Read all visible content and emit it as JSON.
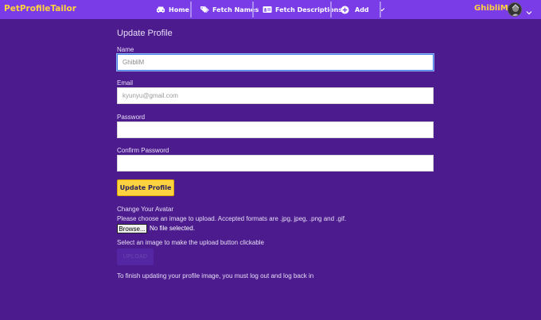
{
  "nav": {
    "brand": "PetProfileTailor",
    "home": "Home",
    "fetch_names": "Fetch Names",
    "fetch_descriptions": "Fetch Descriptions",
    "add": "Add",
    "user_name": "GhibliM"
  },
  "form": {
    "title": "Update Profile",
    "name_label": "Name",
    "name_value": "GhibliM",
    "email_label": "Email",
    "email_placeholder": "kyunyu@gmail.com",
    "password_label": "Password",
    "confirm_password_label": "Confirm Password",
    "update_button": "Update Profile"
  },
  "avatar_section": {
    "heading": "Change Your Avatar",
    "instructions": "Please choose an image to upload. Accepted formats are .jpg, jpeg, .png and .gif.",
    "browse_button": "Browse...",
    "no_file": "No file selected.",
    "select_hint": "Select an image to make the upload button clickable",
    "upload_button": "UPLOAD",
    "finish_note": "To finish updating your profile image, you must log out and log back in"
  },
  "colors": {
    "background": "#4c1c8e",
    "navbar": "#7a3ce6",
    "accent": "#ffd23f"
  }
}
